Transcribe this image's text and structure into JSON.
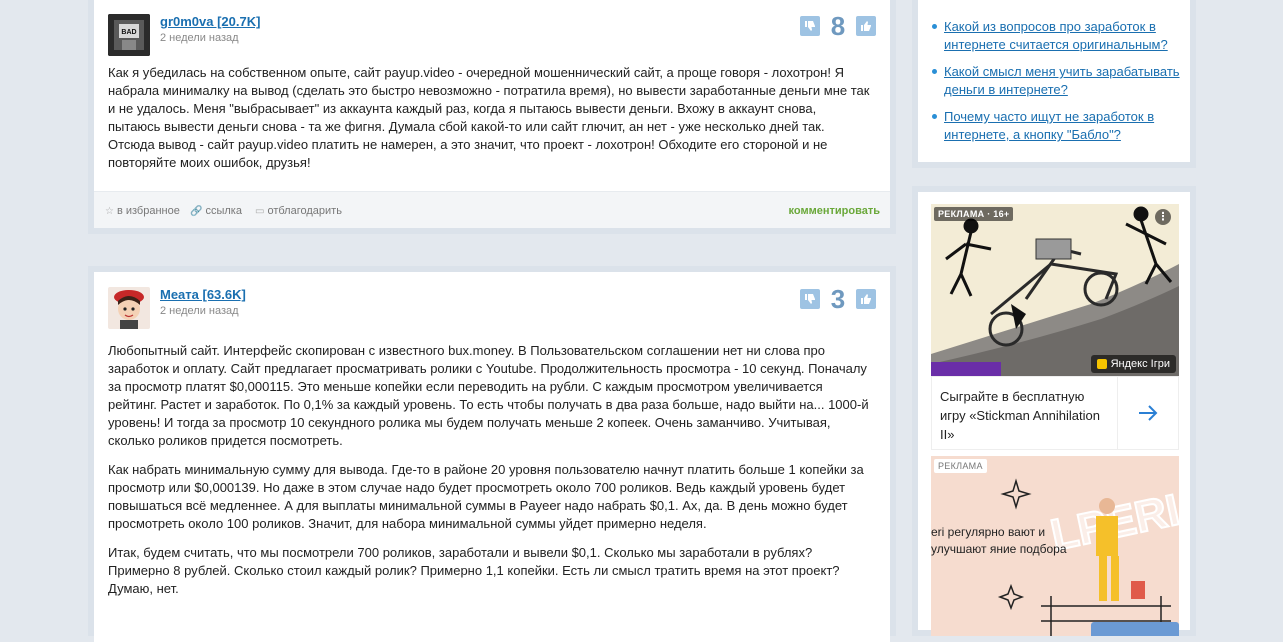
{
  "comments": [
    {
      "author": "gr0m0va [20.7K]",
      "time": "2 недели назад",
      "votes": "8",
      "paragraphs": [
        "Как я убедилась на собственном опыте, сайт payup.video - очередной мошеннический сайт, а проще говоря - лохотрон! Я набрала минималку на вывод (сделать это быстро невозможно - потратила время), но вывести заработанные деньги мне так и не удалось. Меня \"выбрасывает\" из аккаунта каждый раз, когда я пытаюсь вывести деньги. Вхожу в аккаунт снова, пытаюсь вывести деньги снова - та же фигня. Думала сбой какой-то или сайт глючит, ан нет - уже несколько дней так. Отсюда вывод - сайт payup.video платить не намерен, а это значит, что проект - лохотрон! Обходите его стороной и не повторяйте моих ошибок, друзья!"
      ]
    },
    {
      "author": "Меата [63.6K]",
      "time": "2 недели назад",
      "votes": "3",
      "paragraphs": [
        "Любопытный сайт. Интерфейс скопирован с известного bux.money. В Пользовательском соглашении нет ни слова про заработок и оплату. Сайт предлагает просматривать ролики с Youtube. Продолжительность просмотра - 10 секунд. Поначалу за просмотр платят $0,000115. Это меньше копейки если переводить на рубли. С каждым просмотром увеличивается рейтинг. Растет и заработок. По 0,1% за каждый уровень. То есть чтобы получать в два раза больше, надо выйти на... 1000-й уровень! И тогда за просмотр 10 секундного ролика мы будем получать меньше 2 копеек. Очень заманчиво. Учитывая, сколько роликов придется посмотреть.",
        "Как набрать минимальную сумму для вывода. Где-то в районе 20 уровня пользователю начнут платить больше 1 копейки за просмотр или $0,000139. Но даже в этом случае надо будет просмотреть около 700 роликов. Ведь каждый уровень будет повышаться всё медленнее. А для выплаты минимальной суммы в Payeer надо набрать $0,1. Ах, да. В день можно будет просмотреть около 100 роликов. Значит, для набора минимальной суммы уйдет примерно неделя.",
        "Итак, будем считать, что мы посмотрели 700 роликов, заработали и вывели $0,1. Сколько мы заработали в рублях? Примерно 8 рублей. Сколько стоил каждый ролик? Примерно 1,1 копейки. Есть ли смысл тратить время на этот проект? Думаю, нет."
      ]
    }
  ],
  "actions": {
    "favorite": "в избранное",
    "link": "ссылка",
    "thank": "отблагодарить",
    "comment": "комментировать"
  },
  "related": [
    "Какой из вопросов про заработок в интернете считается оригинальным?",
    "Какой смысл меня учить зарабатывать деньги в интернете?",
    "Почему часто ищут не заработок в интернете, а кнопку \"Бабло\"?"
  ],
  "ads": {
    "ad1": {
      "label": "РЕКЛАМА · 16+",
      "badge": "Яндекс Ігри",
      "title": "Сыграйте в бесплатную игру «Stickman Annihilation II»"
    },
    "ad2": {
      "label": "РЕКЛАМА",
      "text": "eri регулярно вают и улучшают яние подбора",
      "brand": "LPERI"
    }
  },
  "colors": {
    "link": "#1a6fb0",
    "vote": "#9ec3e3",
    "comment_link": "#6aa83a"
  }
}
